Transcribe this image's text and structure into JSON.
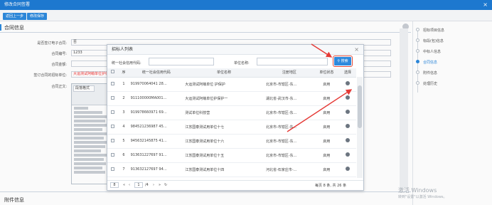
{
  "window": {
    "title": "修改合同签署",
    "close": "×"
  },
  "toolbar": {
    "back_label": "返回上一步",
    "save_label": "修改保存"
  },
  "form": {
    "section_title": "合同信息",
    "rows": [
      {
        "label": "是否签订电子合同:",
        "value": "否"
      },
      {
        "label": "合同编号:",
        "value": "1233"
      },
      {
        "label": "合同金额:",
        "value": ""
      },
      {
        "label": "签订合同的招标单位:",
        "value": "大运测试阿萌单位护保护……"
      },
      {
        "label": "合同正文:",
        "value": ""
      }
    ],
    "editor_style": "段落格式"
  },
  "bottom_section": "附件信息",
  "right_nav": {
    "items": [
      {
        "label": "招标项目信息",
        "active": false
      },
      {
        "label": "标段(包)信息",
        "active": false
      },
      {
        "label": "中标人信息",
        "active": false
      },
      {
        "label": "合同信息",
        "active": true
      },
      {
        "label": "附件信息",
        "active": false
      },
      {
        "label": "处理历史",
        "active": false
      }
    ]
  },
  "modal": {
    "title": "招标人列表",
    "close": "×",
    "credit_code_label": "统一社会信用代码:",
    "company_name_label": "单位名称:",
    "search_label": "搜索",
    "columns": [
      "序",
      "统一社会信用代码",
      "单位名称",
      "注册地区",
      "单位状态",
      "选择"
    ],
    "rows": [
      {
        "no": "1",
        "code": "919970064041 28…",
        "name": "大运测试阿萌单位 护保护",
        "region": "北京市-市辖区-东…",
        "status": "启用"
      },
      {
        "no": "2",
        "code": "911100000MA001…",
        "name": "大运测试阿萌单位护保护一",
        "region": "湖北省-武汉市-东…",
        "status": "启用"
      },
      {
        "no": "3",
        "code": "919978660971 69…",
        "name": "测试单位科技营",
        "region": "北京市-市辖区-东…",
        "status": "启用"
      },
      {
        "no": "4",
        "code": "984521236987 45…",
        "name": "江苏国泰测试用单位十七",
        "region": "北京市-市辖区-东…",
        "status": "启用"
      },
      {
        "no": "5",
        "code": "945632145875 41…",
        "name": "江苏国泰测试用单位十六",
        "region": "北京市-市辖区-东…",
        "status": "启用"
      },
      {
        "no": "6",
        "code": "913631227697 91…",
        "name": "江苏国泰测试用单位十五",
        "region": "北京市-市辖区-东…",
        "status": "启用"
      },
      {
        "no": "7",
        "code": "913632127697 94…",
        "name": "江苏国泰测试用单位十四",
        "region": "河北省-石家庄市-…",
        "status": "启用"
      }
    ],
    "pager": {
      "page_size": "8",
      "page": "1",
      "total_pages": "/4",
      "info": "每页 8 条, 共 26 条"
    }
  },
  "watermark": {
    "line1": "激活 Windows",
    "line2": "转到\"设置\"以激活 Windows。"
  }
}
